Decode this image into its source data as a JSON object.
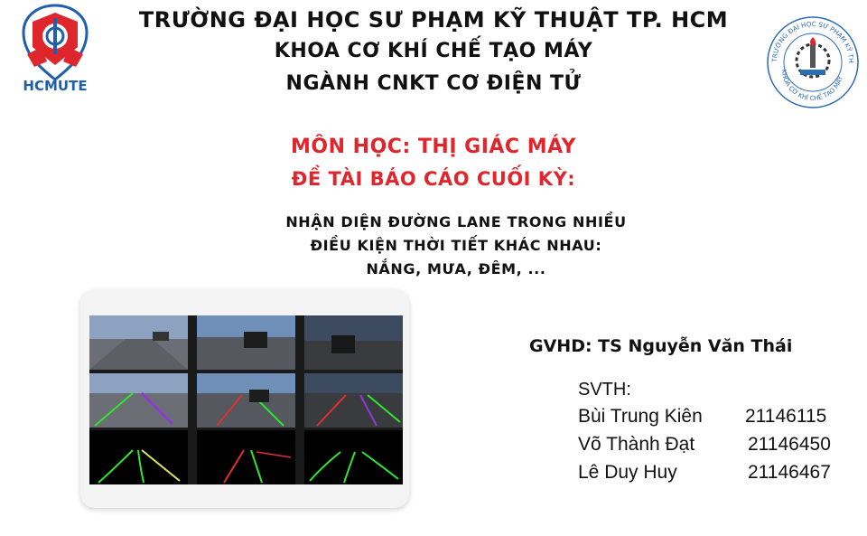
{
  "header": {
    "university": "TRƯỜNG ĐẠI HỌC SƯ PHẠM KỸ THUẬT TP. HCM",
    "faculty": "KHOA CƠ KHÍ CHẾ TẠO MÁY",
    "major": "NGÀNH CNKT CƠ ĐIỆN TỬ"
  },
  "logos": {
    "left_text": "HCMUTE",
    "right_ring_text": "TRƯỜNG ĐẠI HỌC SƯ PHẠM KỸ THUẬT TP.HCM",
    "right_bottom_text": "KHOA CƠ KHÍ CHẾ TẠO MÁY"
  },
  "subject": {
    "course": "MÔN HỌC: THỊ GIÁC MÁY",
    "report": "ĐỀ TÀI BÁO CÁO CUỐI KỲ:"
  },
  "topic": {
    "line1": "NHẬN DIỆN ĐƯỜNG LANE TRONG NHIỀU",
    "line2": "ĐIỀU KIỆN THỜI TIẾT KHÁC NHAU:",
    "line3": "NẮNG, MƯA, ĐÊM, ..."
  },
  "advisor": "GVHD: TS Nguyễn Văn Thái",
  "students_label": "SVTH:",
  "students": [
    {
      "name": "Bùi Trung Kiên",
      "id": "21146115"
    },
    {
      "name": "Võ Thành Đạt",
      "id": "21146450"
    },
    {
      "name": "Lê Duy Huy",
      "id": "21146467"
    }
  ],
  "colors": {
    "accent_red": "#e0262d",
    "logo_blue": "#1f5fae",
    "lane_green": "#2ee62e"
  }
}
